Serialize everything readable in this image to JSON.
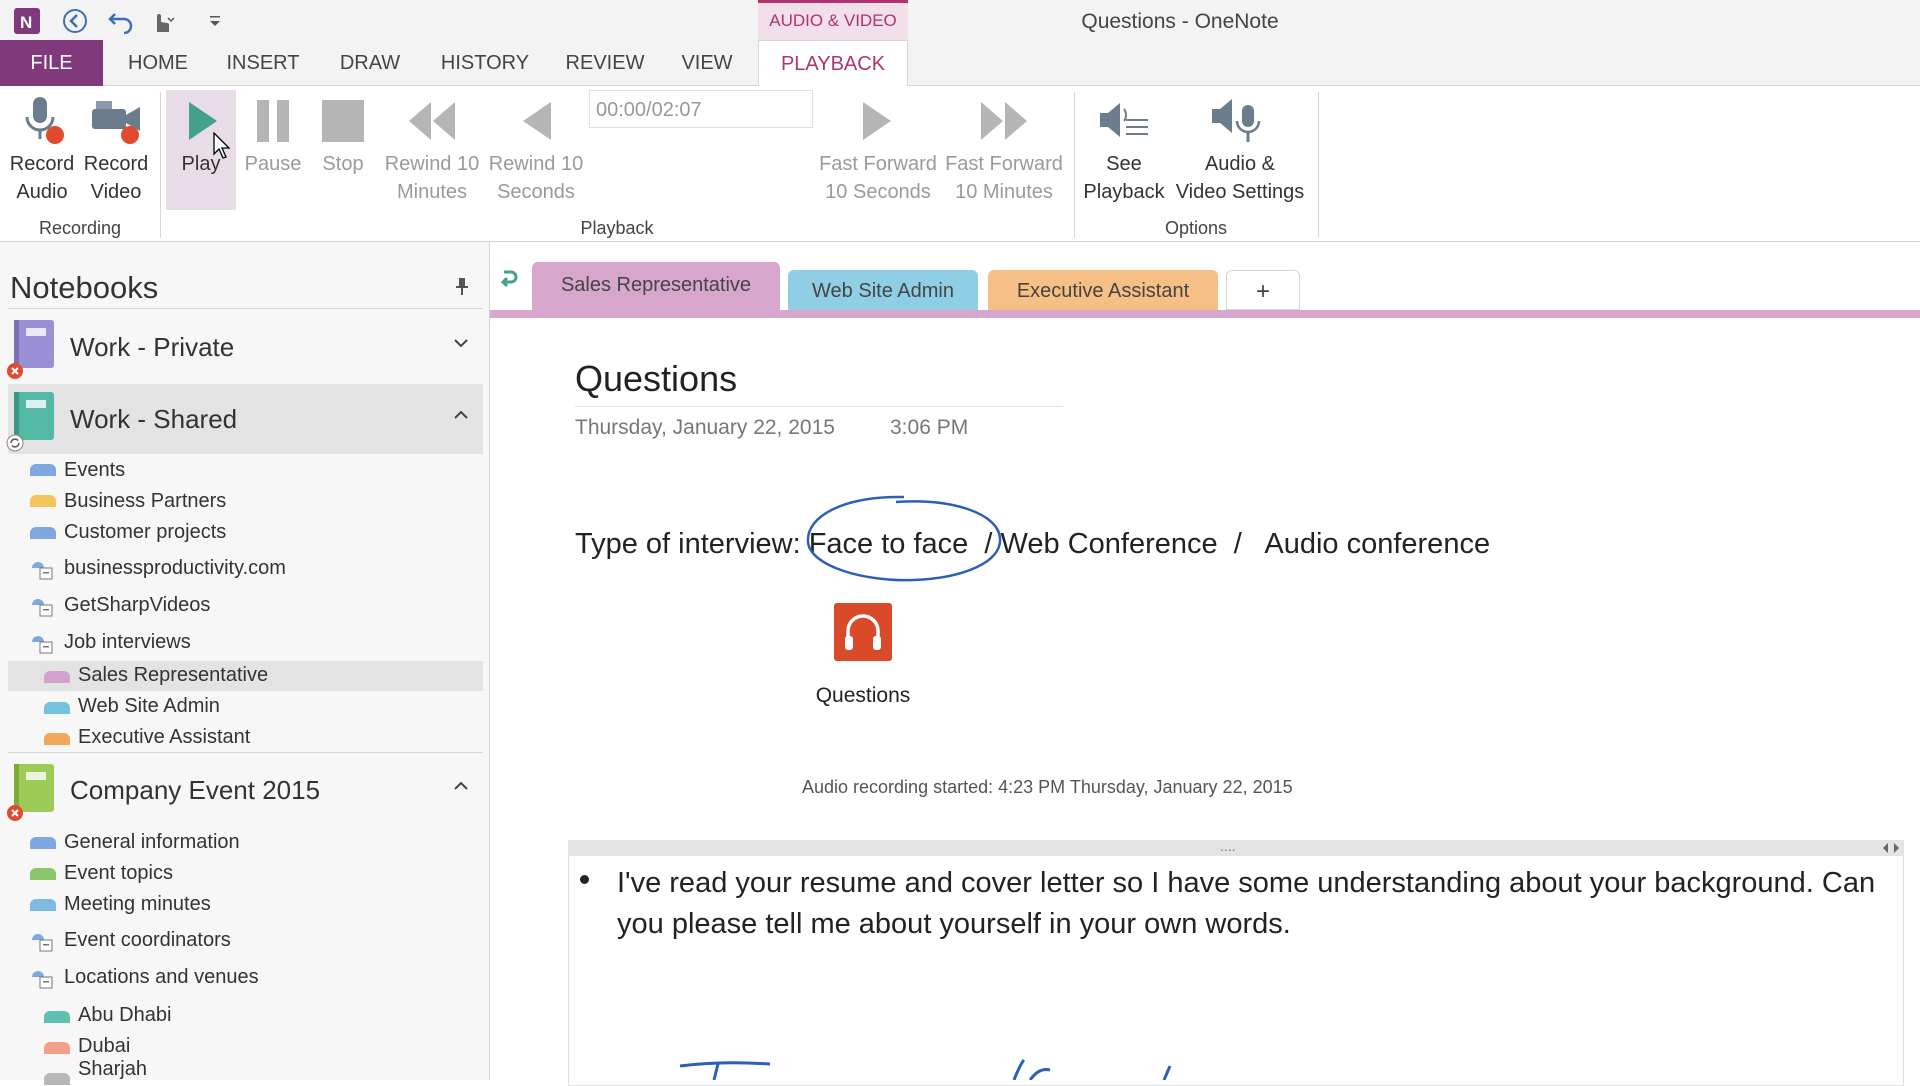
{
  "window": {
    "title": "Questions - OneNote"
  },
  "context_tab": {
    "label": "AUDIO & VIDEO"
  },
  "menu": {
    "file": "FILE",
    "home": "HOME",
    "insert": "INSERT",
    "draw": "DRAW",
    "history": "HISTORY",
    "review": "REVIEW",
    "view": "VIEW",
    "playback": "PLAYBACK"
  },
  "ribbon": {
    "record_audio": [
      "Record",
      "Audio"
    ],
    "record_video": [
      "Record",
      "Video"
    ],
    "play": "Play",
    "pause": "Pause",
    "stop": "Stop",
    "rewind_10_min": [
      "Rewind 10",
      "Minutes"
    ],
    "rewind_10_sec": [
      "Rewind 10",
      "Seconds"
    ],
    "time": "00:00/02:07",
    "ff_10_sec": [
      "Fast Forward",
      "10 Seconds"
    ],
    "ff_10_min": [
      "Fast Forward",
      "10 Minutes"
    ],
    "see_playback": [
      "See",
      "Playback"
    ],
    "av_settings": [
      "Audio &",
      "Video Settings"
    ],
    "groups": {
      "recording": "Recording",
      "playback": "Playback",
      "options": "Options"
    }
  },
  "nav": {
    "title": "Notebooks",
    "notebooks": [
      {
        "name": "Work - Private",
        "color": "#9b8fd6"
      },
      {
        "name": "Work - Shared",
        "color": "#53b8a4"
      },
      {
        "name": "Company Event 2015",
        "color": "#9ccb58"
      }
    ],
    "work_shared_sections": [
      {
        "name": "Events",
        "color": "#7fa7e0"
      },
      {
        "name": "Business Partners",
        "color": "#f3c45a"
      },
      {
        "name": "Customer projects",
        "color": "#7fa7e0"
      },
      {
        "name": "businessproductivity.com",
        "group": true
      },
      {
        "name": "GetSharpVideos",
        "group": true
      },
      {
        "name": "Job interviews",
        "group": true
      }
    ],
    "job_interviews_sections": [
      {
        "name": "Sales Representative",
        "color": "#d6a1cd"
      },
      {
        "name": "Web Site Admin",
        "color": "#72c2dd"
      },
      {
        "name": "Executive Assistant",
        "color": "#f2a65a"
      }
    ],
    "company_event_sections": [
      {
        "name": "General information",
        "color": "#7fa7e0"
      },
      {
        "name": "Event topics",
        "color": "#8cc56a"
      },
      {
        "name": "Meeting minutes",
        "color": "#7fb8e0"
      },
      {
        "name": "Event coordinators",
        "group": true
      },
      {
        "name": "Locations and venues",
        "group": true
      }
    ],
    "locations_sections": [
      {
        "name": "Abu Dhabi",
        "color": "#5dc0b0"
      },
      {
        "name": "Dubai",
        "color": "#f2a08a"
      },
      {
        "name": "Sharjah",
        "color": "#b8b8b8"
      }
    ]
  },
  "page_tabs": [
    {
      "name": "Sales Representative",
      "color": "#d7a6cd"
    },
    {
      "name": "Web Site Admin",
      "color": "#8fcfe6"
    },
    {
      "name": "Executive Assistant",
      "color": "#f6bf86"
    },
    {
      "name": "+",
      "color": "#ffffff"
    }
  ],
  "page": {
    "title": "Questions",
    "date": "Thursday, January 22, 2015",
    "time": "3:06 PM",
    "interview_line": "Type of interview: Face to face  / Web Conference  /   Audio conference",
    "audio_caption": "Questions",
    "recording_started": "Audio recording started: 4:23 PM Thursday, January 22, 2015",
    "container_handle": "....",
    "bullet_text": "I've read your resume and cover letter so I have some understanding about your background. Can you please tell me about yourself in your own words."
  }
}
